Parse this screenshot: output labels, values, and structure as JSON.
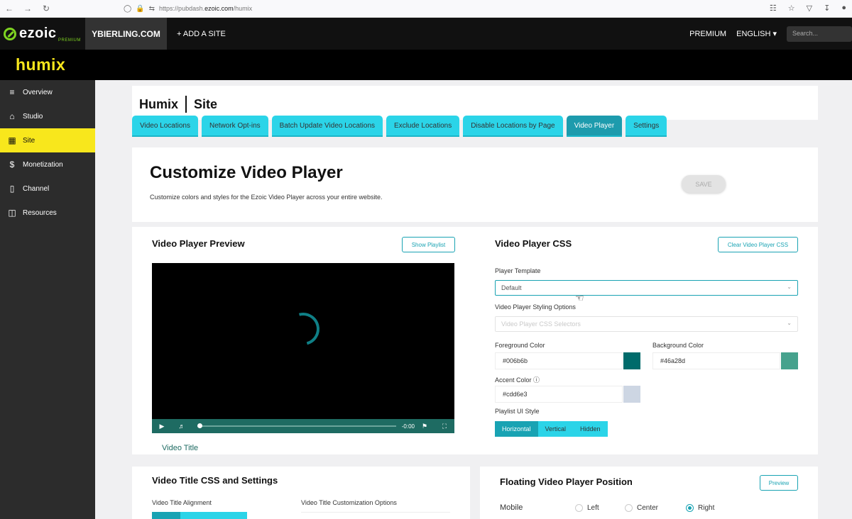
{
  "browser": {
    "url_prefix": "https://pubdash.",
    "url_domain": "ezoic.com",
    "url_suffix": "/humix"
  },
  "topbar": {
    "logo_text": "ezoic",
    "logo_sub": "PREMIUM",
    "site": "YBIERLING.COM",
    "add_site": "+ ADD A SITE",
    "premium": "PREMIUM",
    "language": "ENGLISH",
    "search_placeholder": "Search..."
  },
  "humix": {
    "logo": "humix"
  },
  "sidebar": {
    "items": [
      {
        "label": "Overview",
        "icon": "search-list-icon"
      },
      {
        "label": "Studio",
        "icon": "home-icon"
      },
      {
        "label": "Site",
        "icon": "grid-icon"
      },
      {
        "label": "Monetization",
        "icon": "dollar-icon"
      },
      {
        "label": "Channel",
        "icon": "remote-icon"
      },
      {
        "label": "Resources",
        "icon": "folder-icon"
      }
    ],
    "active_index": 2
  },
  "header": {
    "left": "Humix",
    "right": "Site"
  },
  "tabs": [
    "Video Locations",
    "Network Opt-ins",
    "Batch Update Video Locations",
    "Exclude Locations",
    "Disable Locations by Page",
    "Video Player",
    "Settings"
  ],
  "active_tab": 5,
  "customize": {
    "title": "Customize Video Player",
    "description": "Customize colors and styles for the Ezoic Video Player across your entire website.",
    "save": "SAVE"
  },
  "preview": {
    "title": "Video Player Preview",
    "show_playlist": "Show Playlist",
    "time": "-0:00",
    "video_title": "Video Title"
  },
  "css": {
    "title": "Video Player CSS",
    "clear": "Clear Video Player CSS",
    "template_label": "Player Template",
    "template_value": "Default",
    "styling_label": "Video Player Styling Options",
    "styling_placeholder": "Video Player CSS Selectors",
    "fg_label": "Foreground Color",
    "fg_value": "#006b6b",
    "bg_label": "Background Color",
    "bg_value": "#46a28d",
    "accent_label": "Accent Color",
    "accent_value": "#cdd6e3",
    "playlist_label": "Playlist UI Style",
    "playlist_options": [
      "Horizontal",
      "Vertical",
      "Hidden"
    ],
    "playlist_selected": 0
  },
  "title_settings": {
    "title": "Video Title CSS and Settings",
    "alignment_label": "Video Title Alignment",
    "customization_label": "Video Title Customization Options"
  },
  "floating": {
    "title": "Floating Video Player Position",
    "preview": "Preview",
    "mobile_label": "Mobile",
    "options": [
      "Left",
      "Center",
      "Right"
    ],
    "selected": 2
  }
}
